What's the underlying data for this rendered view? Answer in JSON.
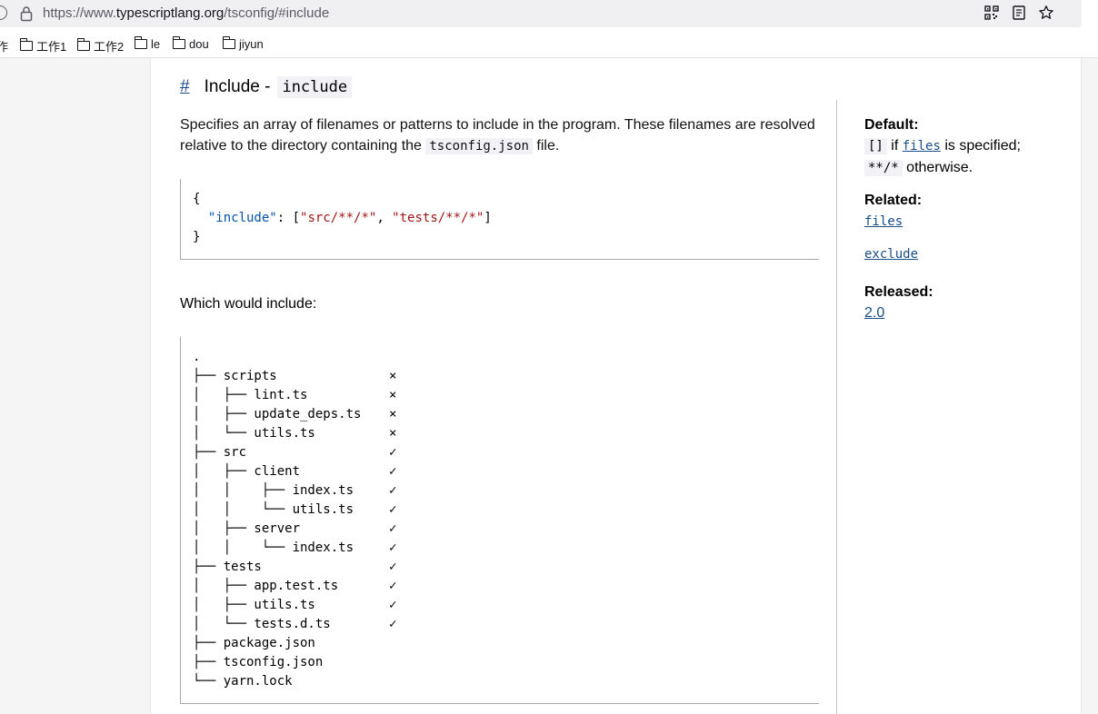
{
  "browser": {
    "url_prefix": "https://www.",
    "url_host": "typescriptlang.org",
    "url_path": "/tsconfig/#include",
    "bookmarks": [
      {
        "label": "作"
      },
      {
        "label": "工作1"
      },
      {
        "label": "工作2"
      },
      {
        "label": "le"
      },
      {
        "label": "dou"
      },
      {
        "label": "jiyun"
      }
    ]
  },
  "section": {
    "anchor": "#",
    "title": "Include -",
    "title_code": "include",
    "desc_part1": "Specifies an array of filenames or patterns to include in the program. These filenames are resolved relative to the directory containing the ",
    "desc_code": "tsconfig.json",
    "desc_part2": " file.",
    "code_line1": "{",
    "code_key": "\"include\"",
    "code_colon": ": [",
    "code_val1": "\"src/**/*\"",
    "code_comma": ", ",
    "code_val2": "\"tests/**/*\"",
    "code_close": "]",
    "code_line3": "}",
    "which": "Which would include:",
    "tree": [
      {
        "name": ".",
        "mark": ""
      },
      {
        "name": "├── scripts",
        "mark": "×"
      },
      {
        "name": "│   ├── lint.ts",
        "mark": "×"
      },
      {
        "name": "│   ├── update_deps.ts",
        "mark": "×"
      },
      {
        "name": "│   └── utils.ts",
        "mark": "×"
      },
      {
        "name": "├── src",
        "mark": "✓"
      },
      {
        "name": "│   ├── client",
        "mark": "✓"
      },
      {
        "name": "│   │    ├── index.ts",
        "mark": "✓"
      },
      {
        "name": "│   │    └── utils.ts",
        "mark": "✓"
      },
      {
        "name": "│   ├── server",
        "mark": "✓"
      },
      {
        "name": "│   │    └── index.ts",
        "mark": "✓"
      },
      {
        "name": "├── tests",
        "mark": "✓"
      },
      {
        "name": "│   ├── app.test.ts",
        "mark": "✓"
      },
      {
        "name": "│   ├── utils.ts",
        "mark": "✓"
      },
      {
        "name": "│   └── tests.d.ts",
        "mark": "✓"
      },
      {
        "name": "├── package.json",
        "mark": ""
      },
      {
        "name": "├── tsconfig.json",
        "mark": ""
      },
      {
        "name": "└── yarn.lock",
        "mark": ""
      }
    ]
  },
  "sidebar": {
    "default_label": "Default:",
    "default_code1": "[]",
    "default_if": " if ",
    "default_link": "files",
    "default_rest": " is specified;",
    "default_code2": "**/*",
    "default_otherwise": " otherwise.",
    "related_label": "Related:",
    "related_links": [
      "files",
      "exclude"
    ],
    "released_label": "Released:",
    "released_version": "2.0"
  }
}
